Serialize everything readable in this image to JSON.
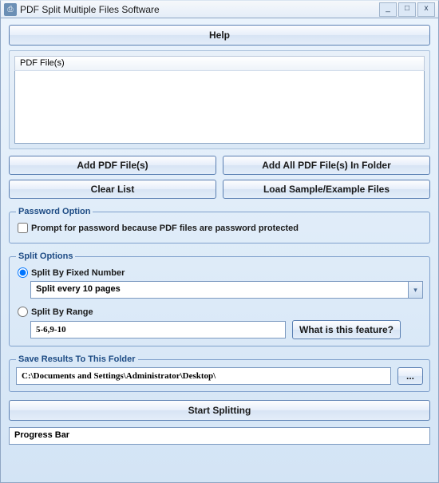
{
  "titlebar": {
    "title": "PDF Split Multiple Files Software"
  },
  "help": {
    "label": "Help"
  },
  "list": {
    "header": "PDF File(s)"
  },
  "buttons": {
    "add": "Add PDF File(s)",
    "add_folder": "Add All PDF File(s) In Folder",
    "clear": "Clear List",
    "load_sample": "Load Sample/Example Files"
  },
  "password": {
    "legend": "Password Option",
    "prompt_label": "Prompt for password because PDF files are password protected"
  },
  "split": {
    "legend": "Split Options",
    "by_fixed_label": "Split By Fixed Number",
    "fixed_value": "Split every 10 pages",
    "by_range_label": "Split By Range",
    "range_value": "5-6,9-10",
    "what_is": "What is this feature?"
  },
  "save": {
    "legend": "Save Results To This Folder",
    "path": "C:\\Documents and Settings\\Administrator\\Desktop\\",
    "browse": "..."
  },
  "start": {
    "label": "Start Splitting"
  },
  "progress": {
    "label": "Progress Bar"
  }
}
